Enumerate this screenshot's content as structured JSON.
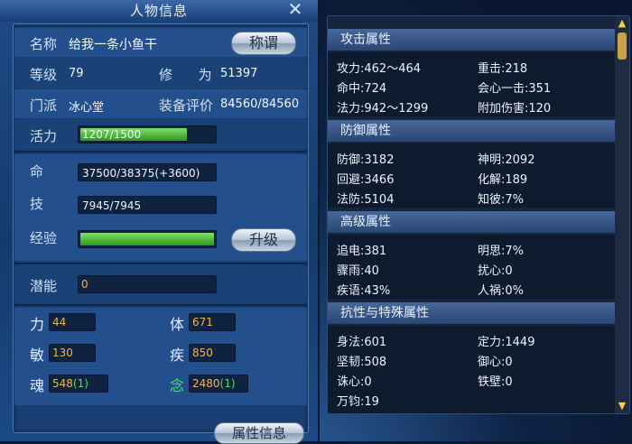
{
  "window": {
    "title": "人物信息",
    "close_label": "✕"
  },
  "character": {
    "name_label": "名称",
    "name": "给我一条小鱼干",
    "title_button": "称谓",
    "level_label": "等级",
    "level": "79",
    "cultivation_label": "修      为",
    "cultivation": "51397",
    "sect_label": "门派",
    "sect": "冰心堂",
    "equip_label": "装备评价",
    "equip_score": "84560/84560",
    "vitality_label": "活力",
    "vitality": "1207/1500",
    "vitality_fraction": 0.8,
    "hp_label": "命",
    "hp": "37500/38375(+3600)",
    "skill_label": "技",
    "skill": "7945/7945",
    "exp_label": "经验",
    "exp_fraction": 1.0,
    "upgrade_button": "升级",
    "potential_label": "潜能",
    "potential": "0",
    "strength_label": "力",
    "strength": "44",
    "constitution_label": "体",
    "constitution": "671",
    "agility_label": "敏",
    "agility": "130",
    "speed_label": "疾",
    "speed": "850",
    "soul_label": "魂",
    "soul": "548",
    "soul_bonus": "(1)",
    "mind_label": "念",
    "mind": "2480",
    "mind_bonus": "(1)"
  },
  "bottom_tab": "属性信息",
  "attributes": {
    "attack": {
      "header": "攻击属性",
      "items": [
        "攻力:462～464",
        "重击:218",
        "命中:724",
        "会心一击:351",
        "法力:942～1299",
        "附加伤害:120"
      ]
    },
    "defense": {
      "header": "防御属性",
      "items": [
        "防御:3182",
        "神明:2092",
        "回避:3466",
        "化解:189",
        "法防:5104",
        "知彼:7%"
      ]
    },
    "advanced": {
      "header": "高级属性",
      "items": [
        "追电:381",
        "明思:7%",
        "骤雨:40",
        "扰心:0",
        "疾语:43%",
        "人祸:0%"
      ]
    },
    "resist": {
      "header": "抗性与特殊属性",
      "items": [
        "身法:601",
        "定力:1449",
        "坚韧:508",
        "御心:0",
        "诛心:0",
        "铁壁:0",
        "万钧:19"
      ]
    }
  },
  "colors": {
    "bar_green": "#3fb52c",
    "stat_orange": "#f3b54a",
    "accent_green": "#49e05a"
  }
}
